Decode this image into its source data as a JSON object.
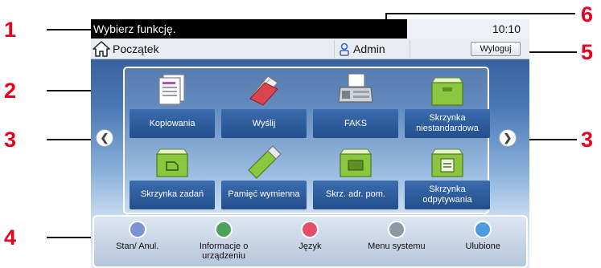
{
  "callouts": [
    "1",
    "2",
    "3",
    "3",
    "4",
    "5",
    "6"
  ],
  "topbar": {
    "message": "Wybierz funkcję.",
    "time": "10:10"
  },
  "navbar": {
    "home_label": "Początek",
    "user": "Admin",
    "logout_label": "Wyloguj"
  },
  "functions": [
    {
      "label": "Kopiowania",
      "icon": "copy-icon"
    },
    {
      "label": "Wyślij",
      "icon": "send-icon"
    },
    {
      "label": "FAKS",
      "icon": "fax-icon"
    },
    {
      "label": "Skrzynka niestandardowa",
      "icon": "custom-box-icon"
    },
    {
      "label": "Skrzynka zadań",
      "icon": "job-box-icon"
    },
    {
      "label": "Pamięć wymienna",
      "icon": "usb-memory-icon"
    },
    {
      "label": "Skrz. adr. pom.",
      "icon": "fax-box-icon"
    },
    {
      "label": "Skrzynka odpytywania",
      "icon": "polling-box-icon"
    }
  ],
  "bottom": [
    {
      "label": "Stan/ Anul.",
      "icon": "status-icon",
      "color": "#7c93d6"
    },
    {
      "label": "Informacje o urządzeniu",
      "icon": "device-info-icon",
      "color": "#4aa35a"
    },
    {
      "label": "Język",
      "icon": "language-icon",
      "color": "#e24f6a"
    },
    {
      "label": "Menu systemu",
      "icon": "system-menu-icon",
      "color": "#8d98a6"
    },
    {
      "label": "Ulubione",
      "icon": "favorites-icon",
      "color": "#4d9ce0"
    }
  ]
}
